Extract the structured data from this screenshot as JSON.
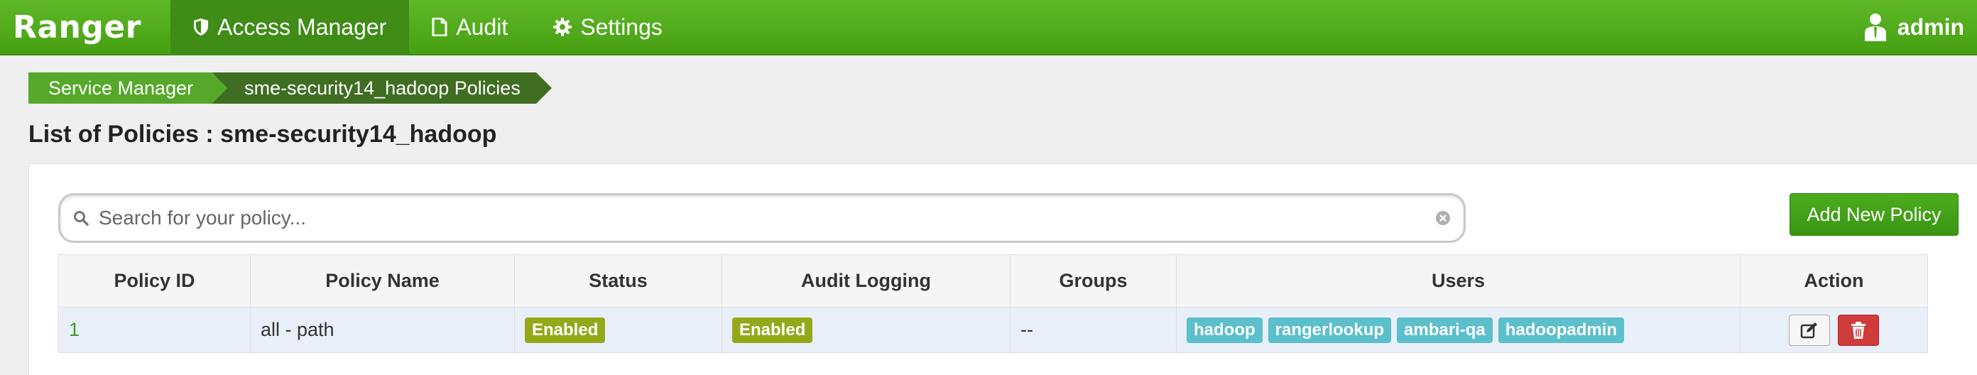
{
  "app": {
    "brand": "Ranger",
    "nav": [
      {
        "label": "Access Manager",
        "icon": "shield-icon",
        "active": true
      },
      {
        "label": "Audit",
        "icon": "document-icon",
        "active": false
      },
      {
        "label": "Settings",
        "icon": "gear-icon",
        "active": false
      }
    ],
    "user": {
      "label": "admin",
      "icon": "user-icon"
    }
  },
  "breadcrumb": [
    "Service Manager",
    "sme-security14_hadoop Policies"
  ],
  "page_title": "List of Policies : sme-security14_hadoop",
  "search": {
    "placeholder": "Search for your policy...",
    "value": ""
  },
  "add_button_label": "Add New Policy",
  "table": {
    "headers": [
      "Policy ID",
      "Policy Name",
      "Status",
      "Audit Logging",
      "Groups",
      "Users",
      "Action"
    ],
    "rows": [
      {
        "id": "1",
        "name": "all - path",
        "status": "Enabled",
        "audit_logging": "Enabled",
        "groups": "--",
        "users": [
          "hadoop",
          "rangerlookup",
          "ambari-qa",
          "hadoopadmin"
        ]
      }
    ]
  },
  "colors": {
    "navbar": "#4ea81c",
    "active_nav": "#3f8c17",
    "breadcrumb_first": "#55a829",
    "breadcrumb_second": "#3f6e23",
    "enabled_label": "#93a91a",
    "user_tag": "#5bbfcc",
    "delete_button": "#cf3a3a"
  }
}
